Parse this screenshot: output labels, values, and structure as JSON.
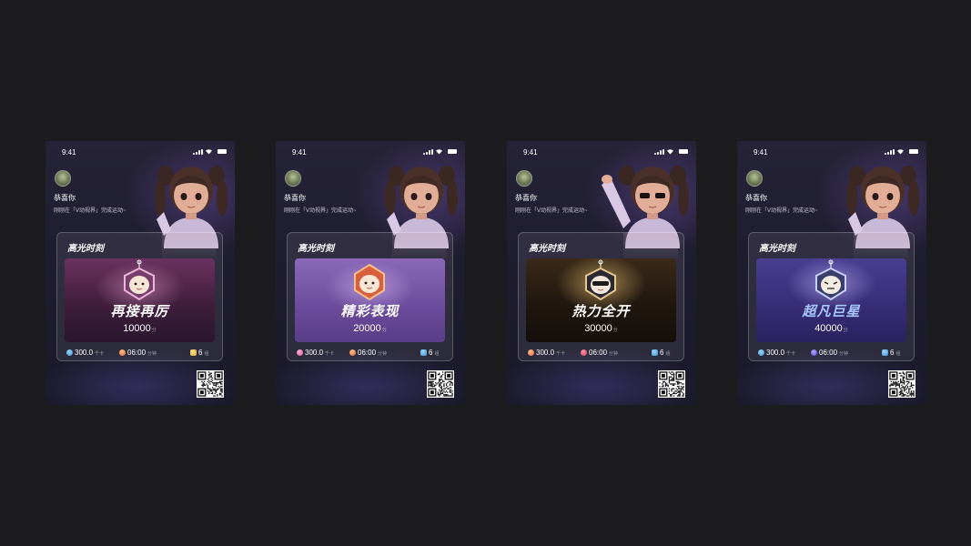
{
  "cards": [
    {
      "time": "9:41",
      "greeting": "恭喜你",
      "subtitle": "刚刚在「V动视界」完成运动~",
      "panel_title": "高光时刻",
      "banner_title": "再接再厉",
      "score": "10000",
      "score_unit": "分",
      "stats": {
        "distance": "300.0",
        "distance_unit": "千卡",
        "duration": "06:00",
        "duration_unit": "分钟",
        "count": "6",
        "count_unit": "组"
      },
      "colors": {
        "banner": "#5a2a4e",
        "accent": "#c08ab0"
      }
    },
    {
      "time": "9:41",
      "greeting": "恭喜你",
      "subtitle": "刚刚在「V动视界」完成运动~",
      "panel_title": "高光时刻",
      "banner_title": "精彩表现",
      "score": "20000",
      "score_unit": "分",
      "stats": {
        "distance": "300.0",
        "distance_unit": "千卡",
        "duration": "06:00",
        "duration_unit": "分钟",
        "count": "6",
        "count_unit": "组"
      },
      "colors": {
        "banner": "#6b4b9a",
        "accent": "#e07a5a"
      }
    },
    {
      "time": "9:41",
      "greeting": "恭喜你",
      "subtitle": "刚刚在「V动视界」完成运动~",
      "panel_title": "高光时刻",
      "banner_title": "热力全开",
      "score": "30000",
      "score_unit": "分",
      "stats": {
        "distance": "300.0",
        "distance_unit": "千卡",
        "duration": "06:00",
        "duration_unit": "分钟",
        "count": "6",
        "count_unit": "组"
      },
      "colors": {
        "banner": "#2a1f14",
        "accent": "#d8a858"
      }
    },
    {
      "time": "9:41",
      "greeting": "恭喜你",
      "subtitle": "刚刚在「V动视界」完成运动~",
      "panel_title": "高光时刻",
      "banner_title": "超凡巨星",
      "score": "40000",
      "score_unit": "分",
      "stats": {
        "distance": "300.0",
        "distance_unit": "千卡",
        "duration": "06:00",
        "duration_unit": "分钟",
        "count": "6",
        "count_unit": "组"
      },
      "colors": {
        "banner": "#3a2f7a",
        "accent": "#8fb4ff"
      }
    }
  ],
  "icons": {
    "calories": "flame-drop-icon",
    "duration": "timer-orb-icon",
    "sets": "star-trophy-icon",
    "qr": "qr-code-icon"
  }
}
